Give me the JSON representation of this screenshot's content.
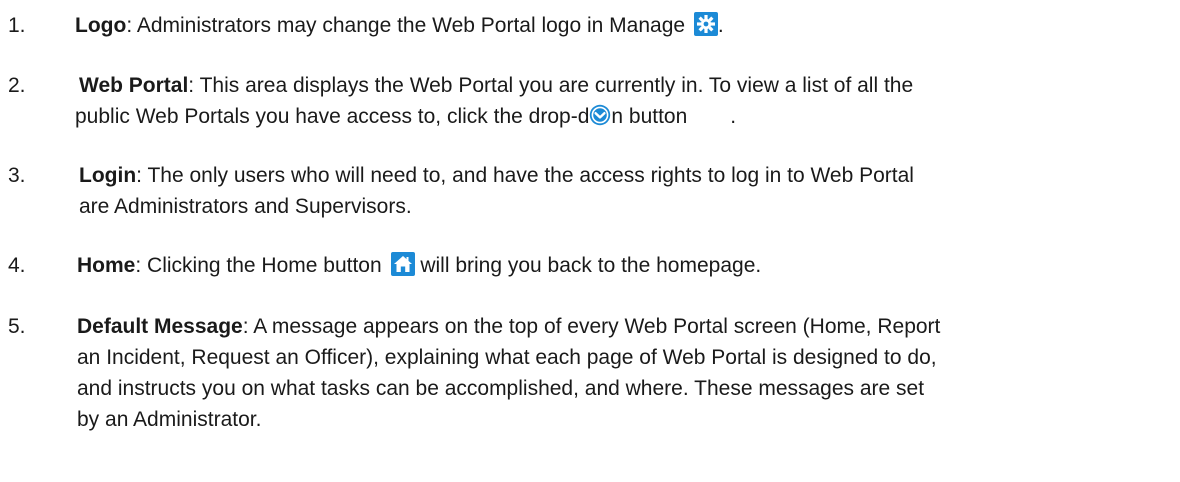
{
  "items": [
    {
      "number": "1.",
      "term": "Logo",
      "text_before_icon": ": Administrators may change the Web Portal logo in Manage",
      "icon": "gear-icon",
      "text_after_icon": "."
    },
    {
      "number": "2.",
      "term": "Web Portal",
      "text_line1": ": This area displays the Web Portal you are currently in. To view a list of all the",
      "text_line2_before_icon": "public Web Portals you have access to, click the drop-d",
      "icon": "chevron-down-circle-icon",
      "text_line2_after_icon": "n button",
      "text_line2_end": "."
    },
    {
      "number": "3.",
      "term": "Login",
      "text_line1": ": The only users who will need to, and have the access rights to log in to Web Portal",
      "text_line2": "are Administrators and Supervisors."
    },
    {
      "number": "4.",
      "term": "Home",
      "text_before_icon": ": Clicking the Home button",
      "icon": "home-icon",
      "text_after_icon": " will bring you back to the homepage."
    },
    {
      "number": "5.",
      "term": "Default Message",
      "text_line1": ": A message appears on the top of every Web Portal screen (Home, Report",
      "text_line2": "an Incident, Request an Officer), explaining what each page of Web Portal is designed to do,",
      "text_line3": "and instructs you on what tasks can be accomplished, and where. These messages are set",
      "text_line4": "by an Administrator."
    }
  ],
  "colors": {
    "icon_blue": "#1c8ad6",
    "text": "#1a1a1a"
  }
}
